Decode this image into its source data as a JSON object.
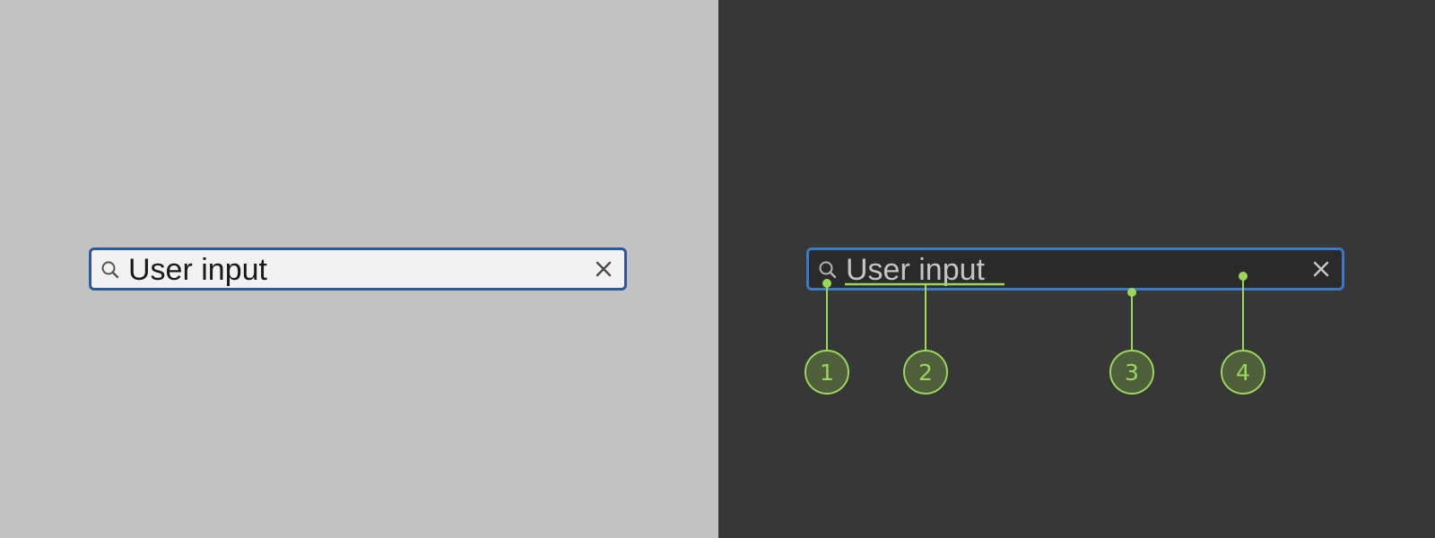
{
  "colors": {
    "light_background": "#c2c2c2",
    "dark_background": "#373737",
    "light_field_fill": "#f2f2f2",
    "dark_field_fill": "#2a2a2a",
    "light_focus_border": "#2a5a9c",
    "dark_focus_border": "#3b7ac6",
    "annotation_green": "#9ad85a"
  },
  "light_variant": {
    "search_icon": "search-icon",
    "input_value": "User input",
    "clear_icon": "close-icon"
  },
  "dark_variant": {
    "search_icon": "search-icon",
    "input_value": "User input",
    "clear_icon": "close-icon"
  },
  "callouts": [
    "1",
    "2",
    "3",
    "4"
  ]
}
